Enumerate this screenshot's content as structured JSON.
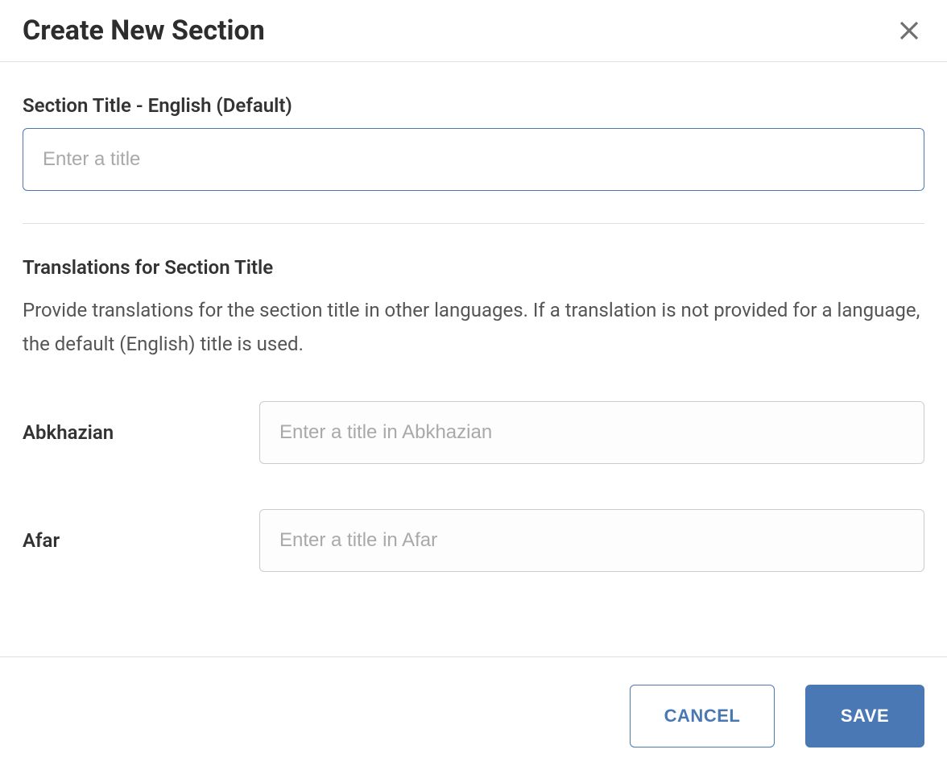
{
  "dialog": {
    "title": "Create New Section"
  },
  "sectionTitle": {
    "label": "Section Title - English (Default)",
    "placeholder": "Enter a title",
    "value": ""
  },
  "translations": {
    "heading": "Translations for Section Title",
    "description": "Provide translations for the section title in other languages. If a translation is not provided for a language, the default (English) title is used.",
    "items": [
      {
        "language": "Abkhazian",
        "placeholder": "Enter a title in Abkhazian",
        "value": ""
      },
      {
        "language": "Afar",
        "placeholder": "Enter a title in Afar",
        "value": ""
      }
    ]
  },
  "footer": {
    "cancel": "CANCEL",
    "save": "SAVE"
  }
}
